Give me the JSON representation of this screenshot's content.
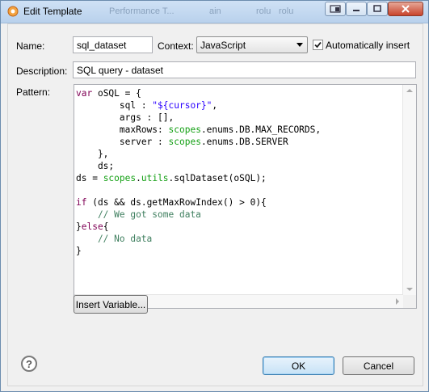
{
  "window": {
    "title": "Edit Template",
    "background_tabs": [
      "Performance T...",
      "ain",
      "rolu",
      "rolu"
    ]
  },
  "form": {
    "name_label": "Name:",
    "name_value": "sql_dataset",
    "context_label": "Context:",
    "context_value": "JavaScript",
    "auto_insert_label": "Automatically insert",
    "auto_insert_checked": true,
    "description_label": "Description:",
    "description_value": "SQL query - dataset",
    "pattern_label": "Pattern:"
  },
  "pattern_lines": [
    [
      {
        "t": "var",
        "c": "kw"
      },
      {
        "t": " oSQL = {"
      }
    ],
    [
      {
        "t": "        sql : "
      },
      {
        "t": "\"${cursor}\"",
        "c": "str"
      },
      {
        "t": ","
      }
    ],
    [
      {
        "t": "        args : [],"
      }
    ],
    [
      {
        "t": "        maxRows: "
      },
      {
        "t": "scopes",
        "c": "scope"
      },
      {
        "t": ".enums.DB.MAX_RECORDS,"
      }
    ],
    [
      {
        "t": "        server : "
      },
      {
        "t": "scopes",
        "c": "scope"
      },
      {
        "t": ".enums.DB.SERVER"
      }
    ],
    [
      {
        "t": "    },"
      }
    ],
    [
      {
        "t": "    ds;"
      }
    ],
    [
      {
        "t": "ds = "
      },
      {
        "t": "scopes",
        "c": "scope"
      },
      {
        "t": "."
      },
      {
        "t": "utils",
        "c": "scope"
      },
      {
        "t": ".sqlDataset(oSQL);"
      }
    ],
    [
      {
        "t": ""
      }
    ],
    [
      {
        "t": "if",
        "c": "kw"
      },
      {
        "t": " (ds && ds.getMaxRowIndex() > "
      },
      {
        "t": "0",
        "c": "num"
      },
      {
        "t": "){"
      }
    ],
    [
      {
        "t": "    // We got some data",
        "c": "cmt"
      }
    ],
    [
      {
        "t": "}"
      },
      {
        "t": "else",
        "c": "kw"
      },
      {
        "t": "{"
      }
    ],
    [
      {
        "t": "    // No data",
        "c": "cmt"
      }
    ],
    [
      {
        "t": "}"
      }
    ]
  ],
  "buttons": {
    "insert_variable": "Insert Variable...",
    "ok": "OK",
    "cancel": "Cancel",
    "help": "?"
  },
  "icons": {
    "app": "template-icon",
    "window_controls": [
      "restore-icon",
      "minimize-icon",
      "maximize-icon",
      "close-icon"
    ]
  }
}
